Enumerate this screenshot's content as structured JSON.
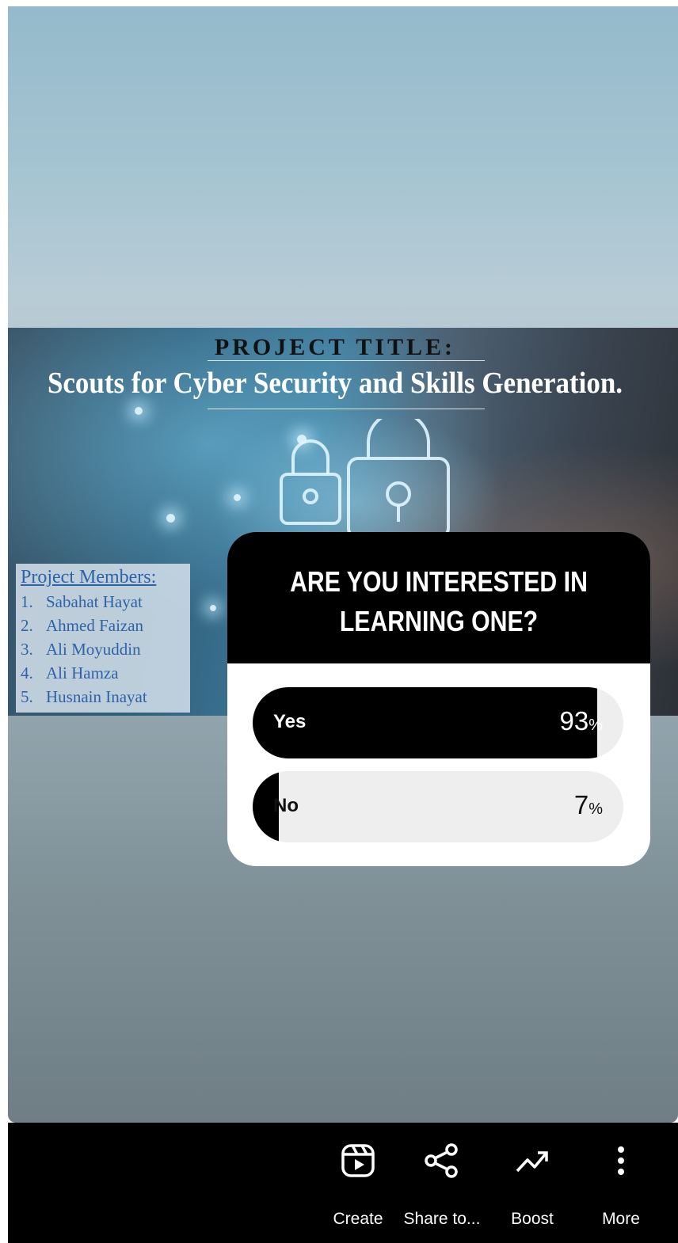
{
  "project_slide": {
    "heading": "PROJECT TITLE:",
    "title": "Scouts for Cyber Security and Skills Generation.",
    "members_heading": "Project Members:",
    "members": [
      {
        "num": "1.",
        "name": "Sabahat Hayat"
      },
      {
        "num": "2.",
        "name": "Ahmed Faizan"
      },
      {
        "num": "3.",
        "name": "Ali Moyuddin"
      },
      {
        "num": "4.",
        "name": "Ali Hamza"
      },
      {
        "num": "5.",
        "name": "Husnain Inayat"
      }
    ]
  },
  "poll": {
    "question": "ARE YOU INTERESTED IN LEARNING ONE?",
    "options": [
      {
        "label": "Yes",
        "percent_value": "93",
        "percent_sign": "%",
        "fraction": 0.93
      },
      {
        "label": "No",
        "percent_value": "7",
        "percent_sign": "%",
        "fraction": 0.07
      }
    ]
  },
  "actions": {
    "create": {
      "label": "Create",
      "icon": "reels-play-icon"
    },
    "share": {
      "label": "Share to...",
      "icon": "share-icon"
    },
    "boost": {
      "label": "Boost",
      "icon": "trending-up-icon"
    },
    "more": {
      "label": "More",
      "icon": "more-vertical-icon"
    }
  },
  "colors": {
    "bar_fill": "#000000",
    "bar_track": "#eeeeee",
    "members_text": "#2d63a8"
  }
}
